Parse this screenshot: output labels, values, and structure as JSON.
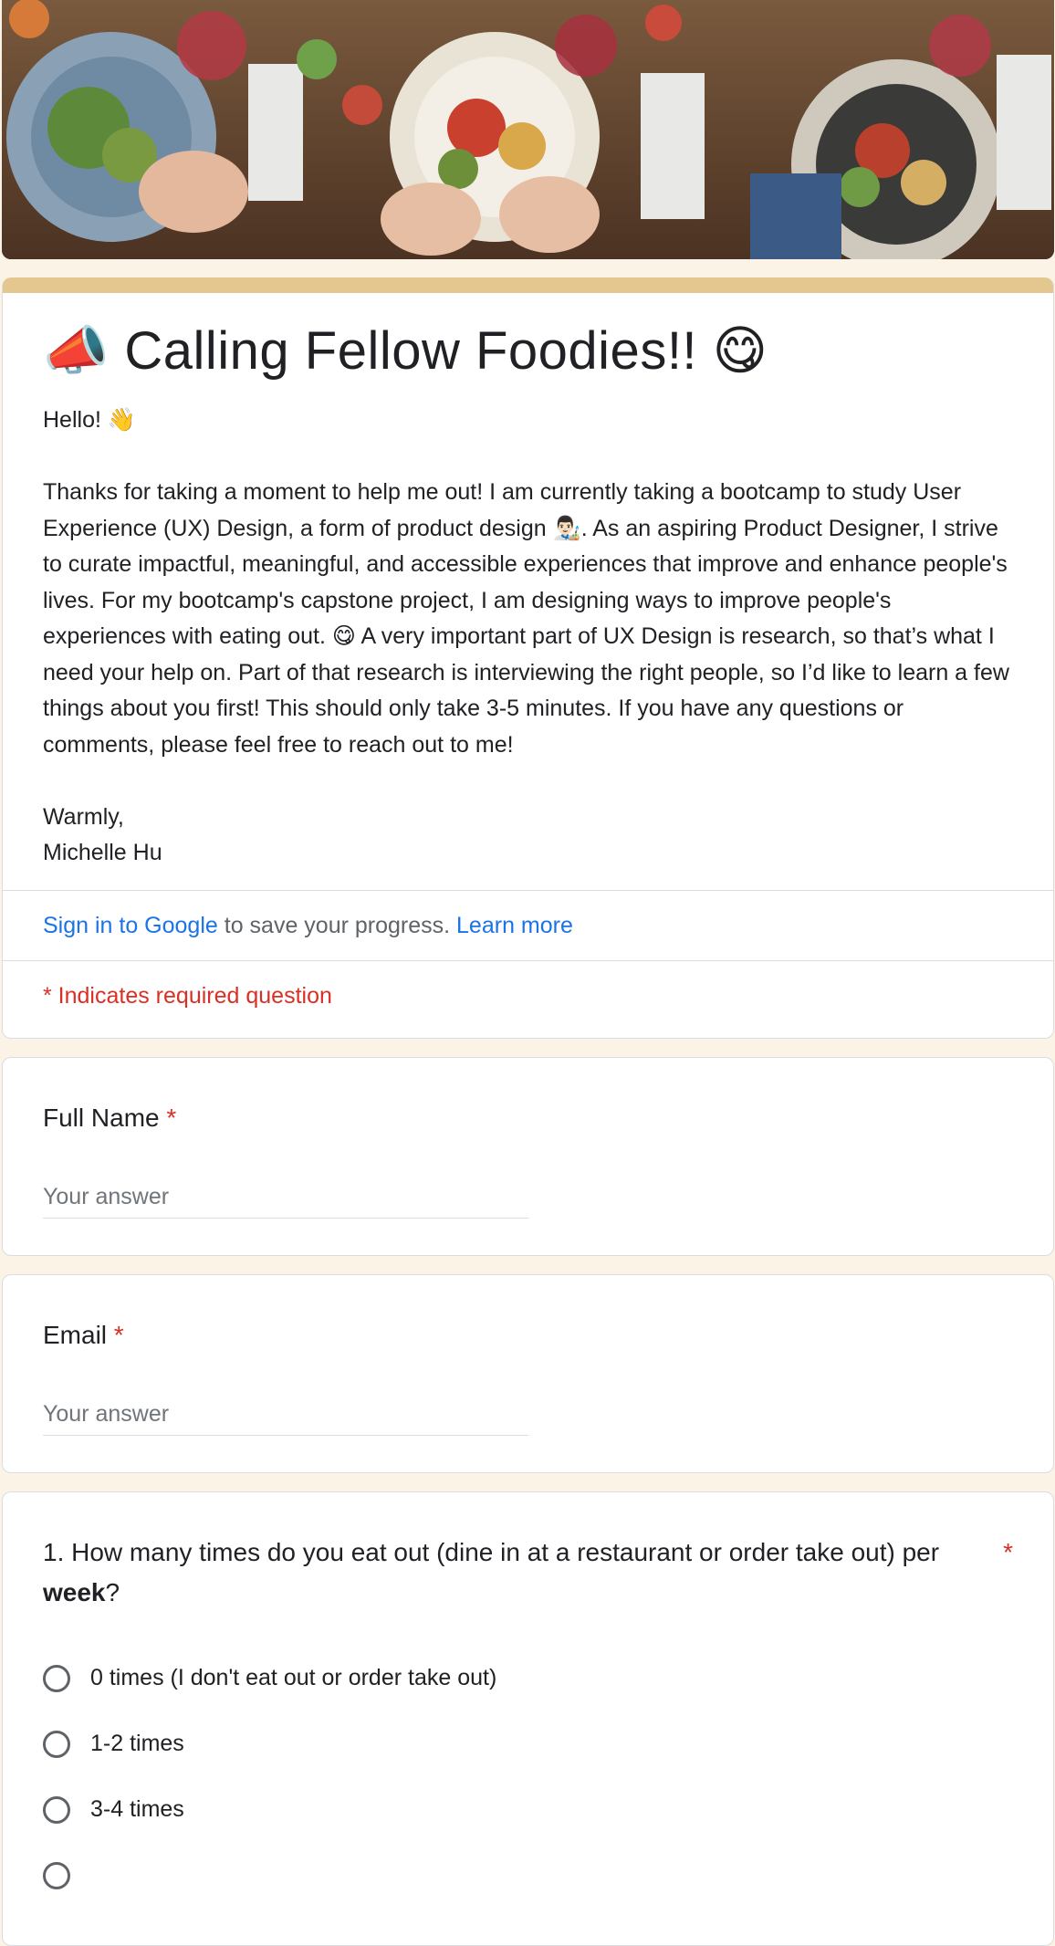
{
  "form": {
    "title": "📣 Calling Fellow Foodies!! 😋",
    "description": "Hello! 👋\n\nThanks for taking a moment to help me out! I am currently taking a bootcamp to study User Experience (UX) Design, a form of product design 👨🏻‍🎨. As an aspiring Product Designer, I strive to curate impactful, meaningful, and accessible experiences that improve and enhance people's lives. For my bootcamp's capstone project, I am designing ways to improve people's experiences with eating out. 😋 A very important part of UX Design is research, so that’s what I need your help on. Part of that research is interviewing the right people, so I’d like to learn a few things about you first! This should only take 3-5 minutes. If you have any questions or comments, please feel free to reach out to me!\n\nWarmly,\nMichelle Hu",
    "signin_link": "Sign in to Google",
    "signin_text": " to save your progress. ",
    "learn_more": "Learn more",
    "required_note": "* Indicates required question"
  },
  "questions": [
    {
      "title": "Full Name",
      "required_mark": "*",
      "placeholder": "Your answer"
    },
    {
      "title": "Email",
      "required_mark": "*",
      "placeholder": "Your answer"
    },
    {
      "title_pre": "1. How many times do you eat out (dine in at a restaurant or order take out) per ",
      "title_bold": "week",
      "title_post": "?",
      "required_mark": "*",
      "options": [
        "0 times (I don't eat out or order take out)",
        "1-2 times",
        "3-4 times"
      ]
    }
  ],
  "theme": {
    "accent": "#e3c78f",
    "background": "#faf3e6",
    "link": "#1a73e8",
    "required": "#d93025"
  }
}
